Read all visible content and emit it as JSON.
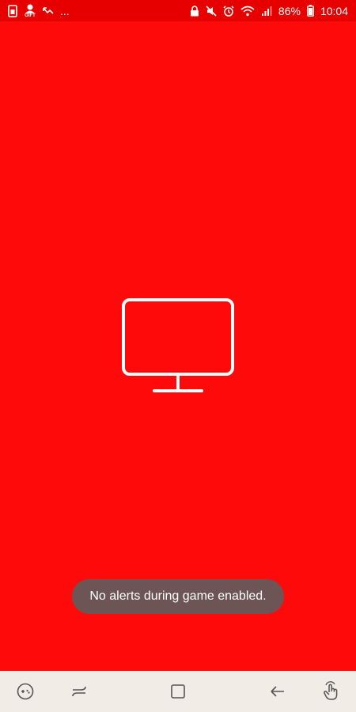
{
  "status_bar": {
    "left_icons": [
      "sim-card-icon",
      "gift-notification-icon",
      "missed-call-icon"
    ],
    "more_indicator": "...",
    "right_icons": [
      "lock-icon",
      "mute-icon",
      "alarm-icon",
      "wifi-icon",
      "signal-icon"
    ],
    "battery_percent": "86%",
    "battery_icon": "battery-icon",
    "time": "10:04",
    "gift_label": "GIFT"
  },
  "center": {
    "icon": "monitor-icon"
  },
  "toast": {
    "message": "No alerts during game enabled."
  },
  "nav_bar": {
    "buttons": [
      "game-tools-icon",
      "recent-apps-icon",
      "home-icon",
      "back-icon",
      "touch-lock-icon"
    ]
  },
  "colors": {
    "background": "#ff0a0a",
    "status_bar": "#e60000",
    "toast_bg": "#6d5555",
    "nav_bar_bg": "#f2ece6",
    "icon": "#ffffff",
    "nav_icon": "#555555"
  }
}
